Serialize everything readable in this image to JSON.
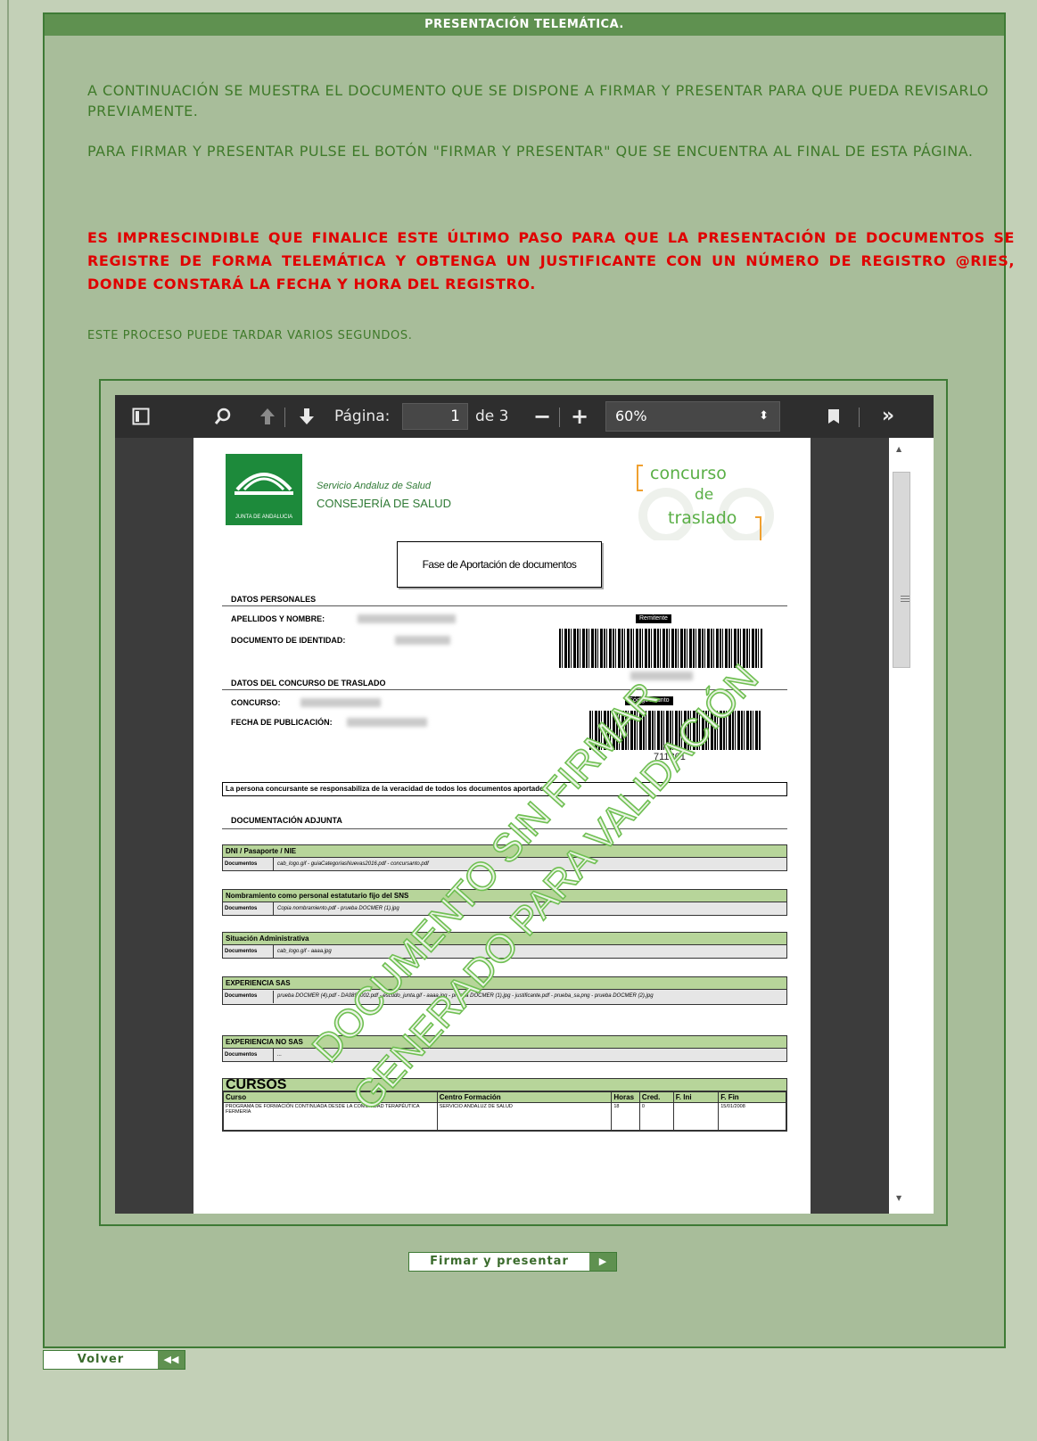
{
  "header": {
    "title": "PRESENTACIÓN TELEMÁTICA."
  },
  "intro": {
    "p1": "A CONTINUACIÓN SE MUESTRA EL DOCUMENTO QUE SE DISPONE A FIRMAR Y PRESENTAR PARA QUE PUEDA REVISARLO PREVIAMENTE.",
    "p2": "PARA FIRMAR Y PRESENTAR PULSE EL BOTÓN \"FIRMAR Y PRESENTAR\" QUE SE ENCUENTRA AL FINAL DE ESTA PÁGINA.",
    "warning": "ES IMPRESCINDIBLE QUE FINALICE ESTE ÚLTIMO PASO PARA QUE LA PRESENTACIÓN DE DOCUMENTOS SE REGISTRE DE FORMA TELEMÁTICA Y OBTENGA UN JUSTIFICANTE CON UN NÚMERO DE REGISTRO @RIES, DONDE CONSTARÁ LA FECHA Y HORA DEL REGISTRO.",
    "note": "ESTE PROCESO PUEDE TARDAR VARIOS SEGUNDOS."
  },
  "viewer": {
    "page_label": "Página:",
    "page_value": "1",
    "page_total": "de 3",
    "zoom": "60%",
    "icons": [
      "sidebar-toggle-icon",
      "search-icon",
      "previous-page-icon",
      "next-page-icon",
      "zoom-out-icon",
      "zoom-in-icon",
      "bookmark-icon",
      "tools-icon"
    ]
  },
  "document": {
    "logo_caption": "JUNTA DE ANDALUCIA",
    "org_line1": "Servicio Andaluz de Salud",
    "org_line2": "CONSEJERÍA DE SALUD",
    "brand_line1": "concurso",
    "brand_line2": "de",
    "brand_line3": "traslado",
    "phase_title": "Fase de Aportación de documentos",
    "personal_title": "DATOS PERSONALES",
    "label_name": "APELLIDOS Y NOMBRE:",
    "label_id": "DOCUMENTO DE IDENTIDAD:",
    "contest_title": "DATOS DEL CONCURSO DE TRASLADO",
    "label_contest": "CONCURSO:",
    "label_pubdate": "FECHA DE PUBLICACIÓN:",
    "barcode1_label": "Remitente",
    "barcode2_label": "Código Asunto",
    "barcode2_number": "711861",
    "responsibility": "La persona concursante se responsabiliza de la veracidad de todos los documentos aportados.",
    "attachments_title": "DOCUMENTACIÓN ADJUNTA",
    "groups": [
      {
        "title": "DNI / Pasaporte / NIE",
        "label": "Documentos",
        "files": "cab_logo.gif  -  guiaCategoriasNuevas2016.pdf  -  concursanto.pdf"
      },
      {
        "title": "Nombramiento como personal estatutario fijo del SNS",
        "label": "Documentos",
        "files": "Copia nombramiento.pdf  -  prueba DOCMER (1).jpg"
      },
      {
        "title": "Situación Administrativa",
        "label": "Documentos",
        "files": "cab_logo.gif  -  aaaa.jpg"
      },
      {
        "title": "EXPERIENCIA SAS",
        "label": "Documentos",
        "files": "prueba DOCMER (4).pdf  -  DA0890002.pdf  -  escudo_junta.gif  -  aaaa.jpg  -  prueba DOCMER (1).jpg  -  justificante.pdf  -  prueba_sa.png  -  prueba DOCMER (2).jpg"
      },
      {
        "title": "EXPERIENCIA NO SAS",
        "label": "Documentos",
        "files": "..."
      }
    ],
    "courses_title": "CURSOS",
    "courses_headers": [
      "Curso",
      "Centro Formación",
      "Horas",
      "Cred.",
      "F. Ini",
      "F. Fin"
    ],
    "courses_rows": [
      [
        "PROGRAMA DE FORMACIÓN CONTINUADA DESDE LA COMUNIDAD TERAPÉUTICA FERMERÍA",
        "SERVICIO ANDALUZ DE SALUD",
        "18",
        "0",
        "",
        "15/01/2008"
      ]
    ],
    "watermark_line1": "DOCUMENTO SIN FIRMAR",
    "watermark_line2": "GENERADO PARA VALIDACIÓN"
  },
  "actions": {
    "submit_label": "Firmar y presentar",
    "back_label": "Volver"
  },
  "colors": {
    "page_bg": "#c3d0b7",
    "panel_bg": "#a8bd9a",
    "header_bg": "#5f9150",
    "text_green": "#3f7a2a",
    "warning_red": "#e00000"
  }
}
